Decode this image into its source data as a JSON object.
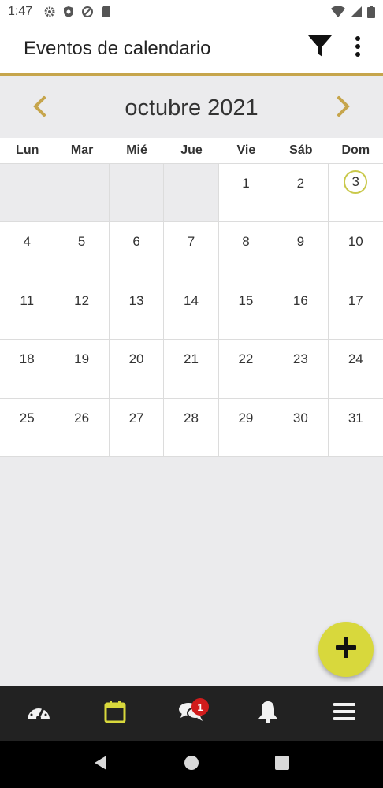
{
  "status_bar": {
    "time": "1:47",
    "icons": [
      "gear-icon",
      "shield-icon",
      "no-tracking-icon",
      "sd-card-icon"
    ],
    "right_icons": [
      "wifi-icon",
      "signal-icon",
      "battery-icon"
    ]
  },
  "app_bar": {
    "title": "Eventos de calendario",
    "actions": [
      "filter-icon",
      "more-vertical-icon"
    ]
  },
  "calendar": {
    "month_title": "octubre 2021",
    "weekdays": [
      "Lun",
      "Mar",
      "Mié",
      "Jue",
      "Vie",
      "Sáb",
      "Dom"
    ],
    "leading_empty_days": 4,
    "days_in_month": 31,
    "today": 3
  },
  "fab": {
    "icon": "plus-icon"
  },
  "bottom_nav": {
    "items": [
      {
        "icon": "dashboard-icon"
      },
      {
        "icon": "calendar-icon",
        "active": true
      },
      {
        "icon": "chat-icon",
        "badge": "1"
      },
      {
        "icon": "bell-icon"
      },
      {
        "icon": "menu-icon"
      }
    ]
  },
  "colors": {
    "accent_gold": "#c6a54c",
    "accent_yellow": "#d8d83c",
    "today_ring": "#c9c84a",
    "badge_red": "#d01c1c",
    "bottom_nav_bg": "#222222"
  }
}
